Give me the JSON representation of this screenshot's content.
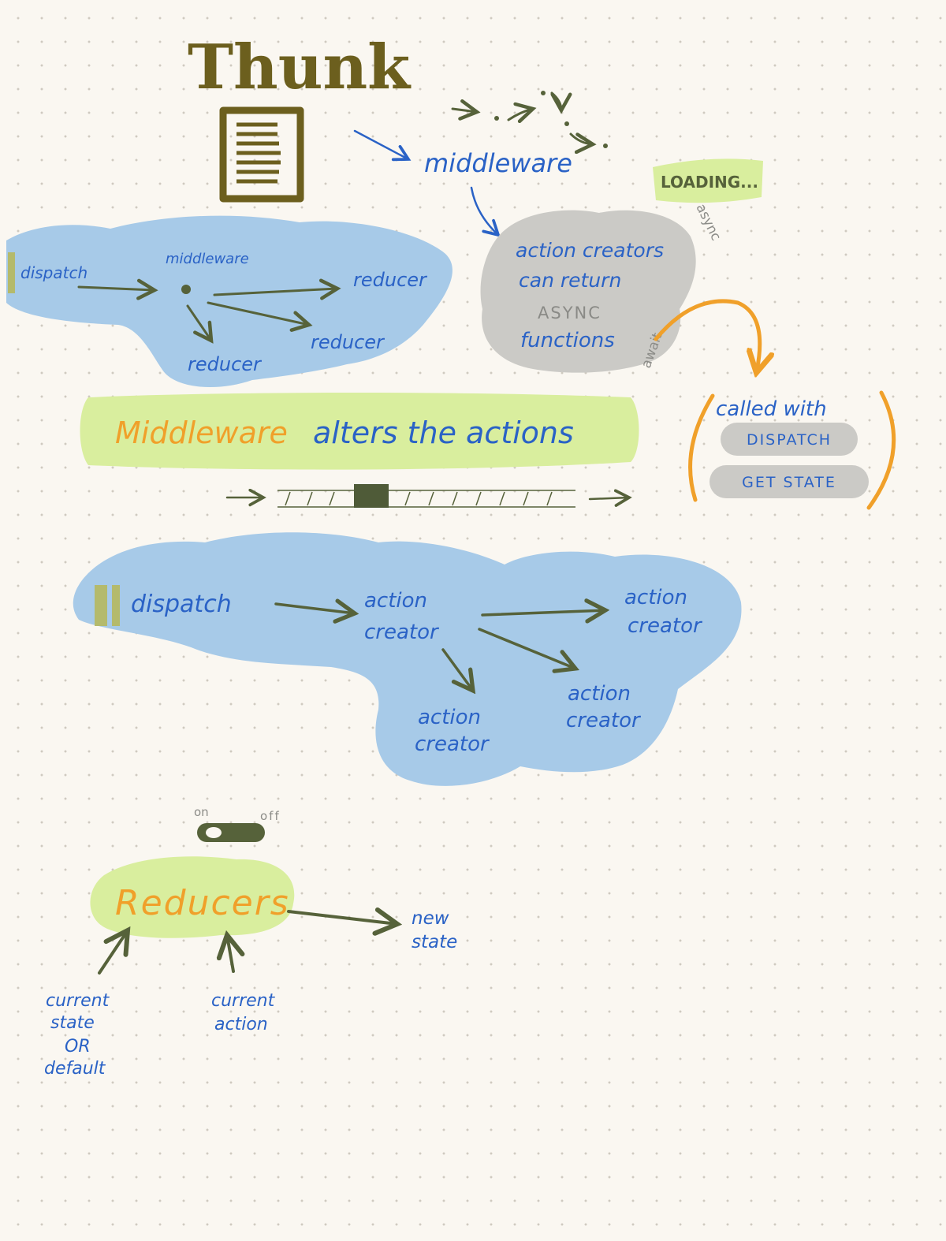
{
  "title": "Thunk",
  "top_middleware": "middleware",
  "loading": "LOADING...",
  "async_note": "async",
  "await_note": "await",
  "async_box": {
    "line1": "action creators",
    "line2": "can return",
    "line3": "ASYNC",
    "line4": "functions"
  },
  "called_with": {
    "label": "called with",
    "dispatch": "DISPATCH",
    "get_state": "GET STATE"
  },
  "flow1": {
    "dispatch": "dispatch",
    "middleware": "middleware",
    "reducer_right": "reducer",
    "reducer_mid": "reducer",
    "reducer_bottom": "reducer"
  },
  "banner": {
    "word1": "Middleware",
    "rest": "alters the actions"
  },
  "flow2": {
    "dispatch": "dispatch",
    "ac_main_1": "action",
    "ac_main_2": "creator",
    "ac_right_1": "action",
    "ac_right_2": "creator",
    "ac_mid_1": "action",
    "ac_mid_2": "creator",
    "ac_bottom_1": "action",
    "ac_bottom_2": "creator"
  },
  "toggle": {
    "on": "on",
    "off": "off"
  },
  "reducers": {
    "title": "Reducers",
    "new_1": "new",
    "new_2": "state",
    "cs_1": "current",
    "cs_2": "state",
    "cs_3": "OR",
    "cs_4": "default",
    "ca_1": "current",
    "ca_2": "action"
  },
  "colors": {
    "blue_blob": "#a7cae8",
    "grey_blob": "#cbcac6",
    "lime": "#d9ee9e",
    "ink_blue": "#2a62c6",
    "olive": "#56623a",
    "orange": "#f0a02a",
    "title_olive": "#6c5f1e"
  }
}
